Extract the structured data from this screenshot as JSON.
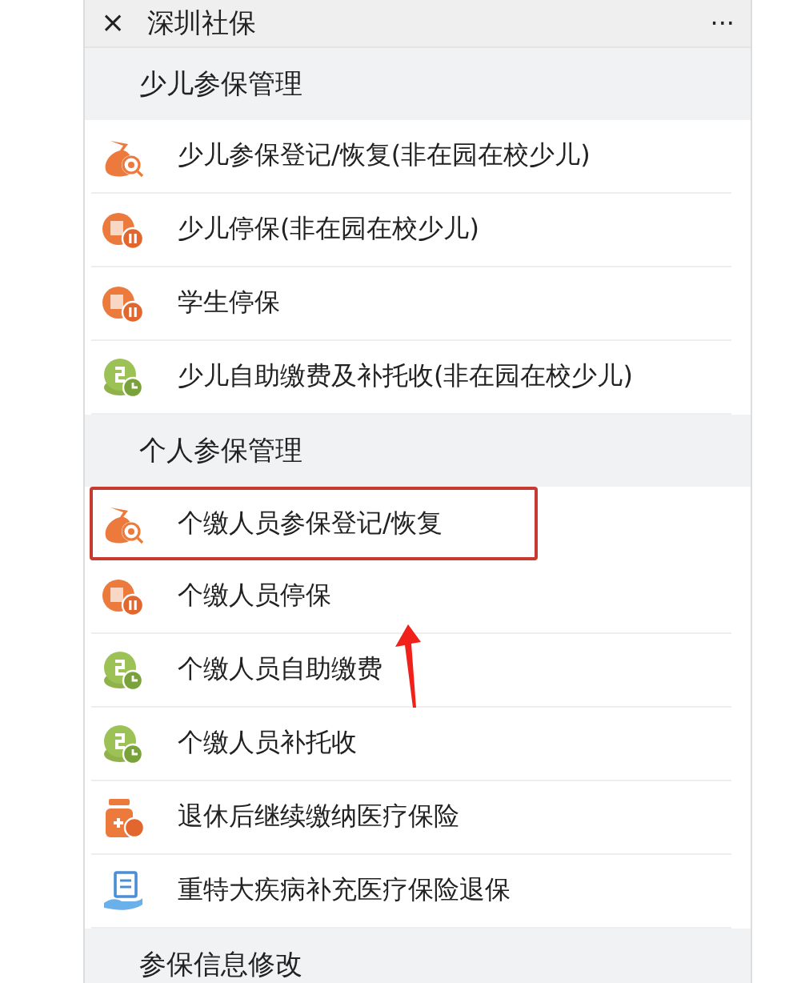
{
  "header": {
    "close": "×",
    "title": "深圳社保",
    "more": "···"
  },
  "sections": [
    {
      "title": "少儿参保管理",
      "items": [
        {
          "label": "少儿参保登记/恢复(非在园在校少儿)",
          "kind": "bag",
          "highlighted": false
        },
        {
          "label": "少儿停保(非在园在校少儿)",
          "kind": "pause",
          "highlighted": false
        },
        {
          "label": "学生停保",
          "kind": "pause",
          "highlighted": false
        },
        {
          "label": "少儿自助缴费及补托收(非在园在校少儿)",
          "kind": "coins",
          "highlighted": false
        }
      ]
    },
    {
      "title": "个人参保管理",
      "items": [
        {
          "label": "个缴人员参保登记/恢复",
          "kind": "bag",
          "highlighted": true
        },
        {
          "label": "个缴人员停保",
          "kind": "pause",
          "highlighted": false
        },
        {
          "label": "个缴人员自助缴费",
          "kind": "coins",
          "highlighted": false
        },
        {
          "label": "个缴人员补托收",
          "kind": "coins",
          "highlighted": false
        },
        {
          "label": "退休后继续缴纳医疗保险",
          "kind": "medicine",
          "highlighted": false
        },
        {
          "label": "重特大疾病补充医疗保险退保",
          "kind": "hand",
          "highlighted": false
        }
      ]
    },
    {
      "title": "参保信息修改"
    }
  ]
}
